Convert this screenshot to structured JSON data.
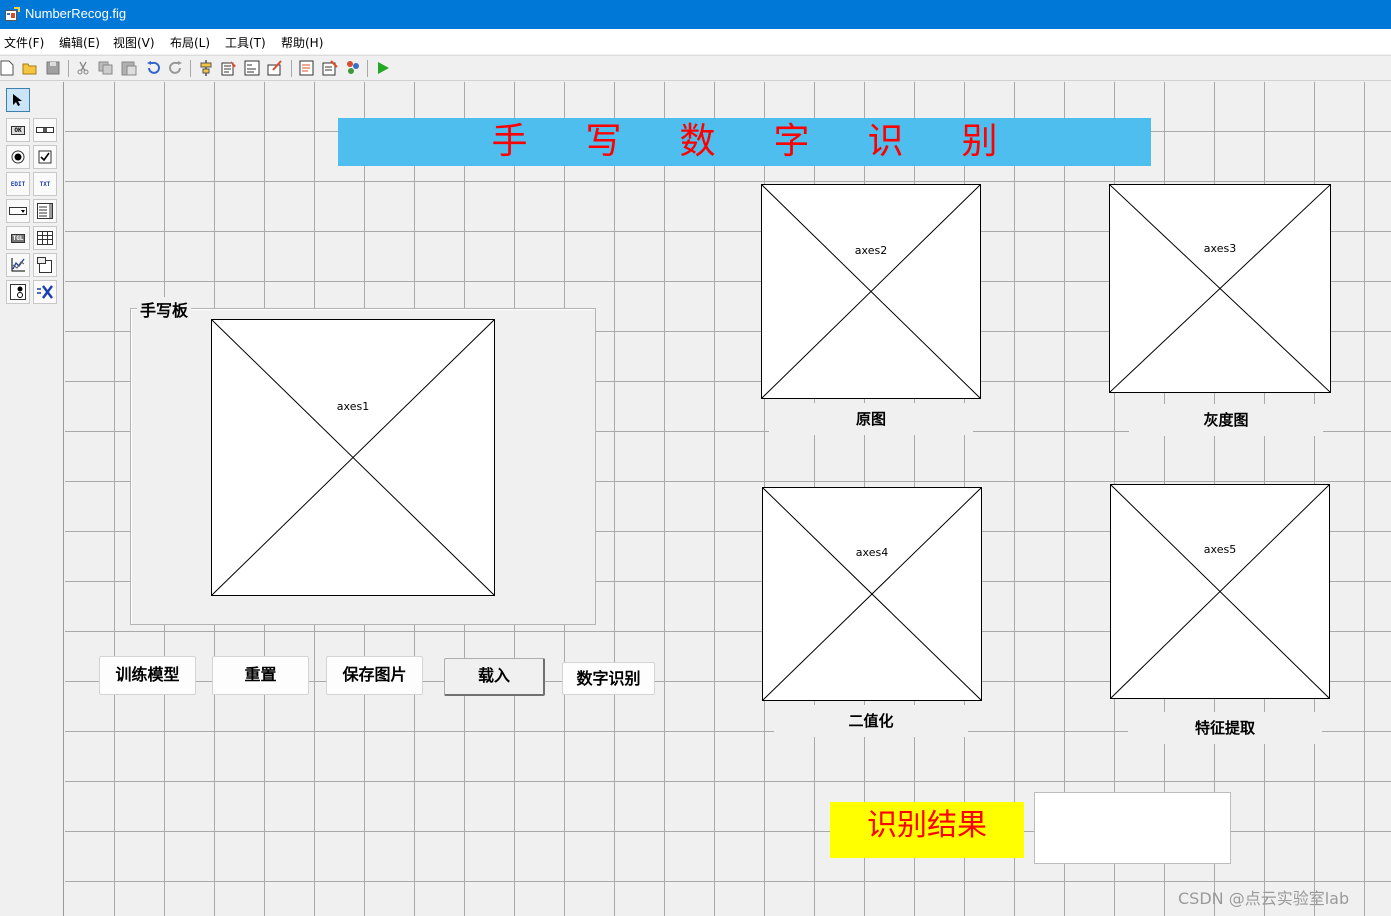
{
  "window": {
    "title": "NumberRecog.fig",
    "title_bar_color": "#0078d7"
  },
  "menu": [
    "文件(F)",
    "编辑(E)",
    "视图(V)",
    "布局(L)",
    "工具(T)",
    "帮助(H)"
  ],
  "toolbar": {
    "icons": [
      "new-file-icon",
      "open-folder-icon",
      "save-icon",
      "cut-icon",
      "copy-icon",
      "paste-icon",
      "undo-icon",
      "redo-icon",
      "align-icon",
      "menu-editor-icon",
      "tab-order-icon",
      "toolbar-editor-icon",
      "editor-icon",
      "property-inspector-icon",
      "object-browser-icon",
      "run-icon"
    ]
  },
  "palette": {
    "tools": [
      "select-tool",
      "push-button-tool",
      "slider-tool",
      "radio-button-tool",
      "checkbox-tool",
      "edit-text-tool",
      "static-text-tool",
      "popup-menu-tool",
      "listbox-tool",
      "toggle-button-tool",
      "table-tool",
      "axes-tool",
      "panel-tool",
      "button-group-tool",
      "activex-tool"
    ],
    "labels": {
      "push": "OK",
      "edit": "EDIT",
      "text": "TXT",
      "toggle": "TGL"
    }
  },
  "figure": {
    "title": "手写数字识别",
    "title_colors": {
      "background": "#4dbeee",
      "text": "#ff0000"
    },
    "panel_title": "手写板",
    "axes": {
      "a1": "axes1",
      "a2": "axes2",
      "a3": "axes3",
      "a4": "axes4",
      "a5": "axes5"
    },
    "labels": {
      "original": "原图",
      "gray": "灰度图",
      "binary": "二值化",
      "feature": "特征提取"
    },
    "buttons": {
      "train": "训练模型",
      "reset": "重置",
      "save": "保存图片",
      "load": "载入",
      "recognize": "数字识别"
    },
    "result": {
      "label": "识别结果",
      "label_colors": {
        "background": "#ffff00",
        "text": "#ff0000"
      },
      "value": ""
    }
  },
  "watermark": "CSDN @点云实验室lab"
}
